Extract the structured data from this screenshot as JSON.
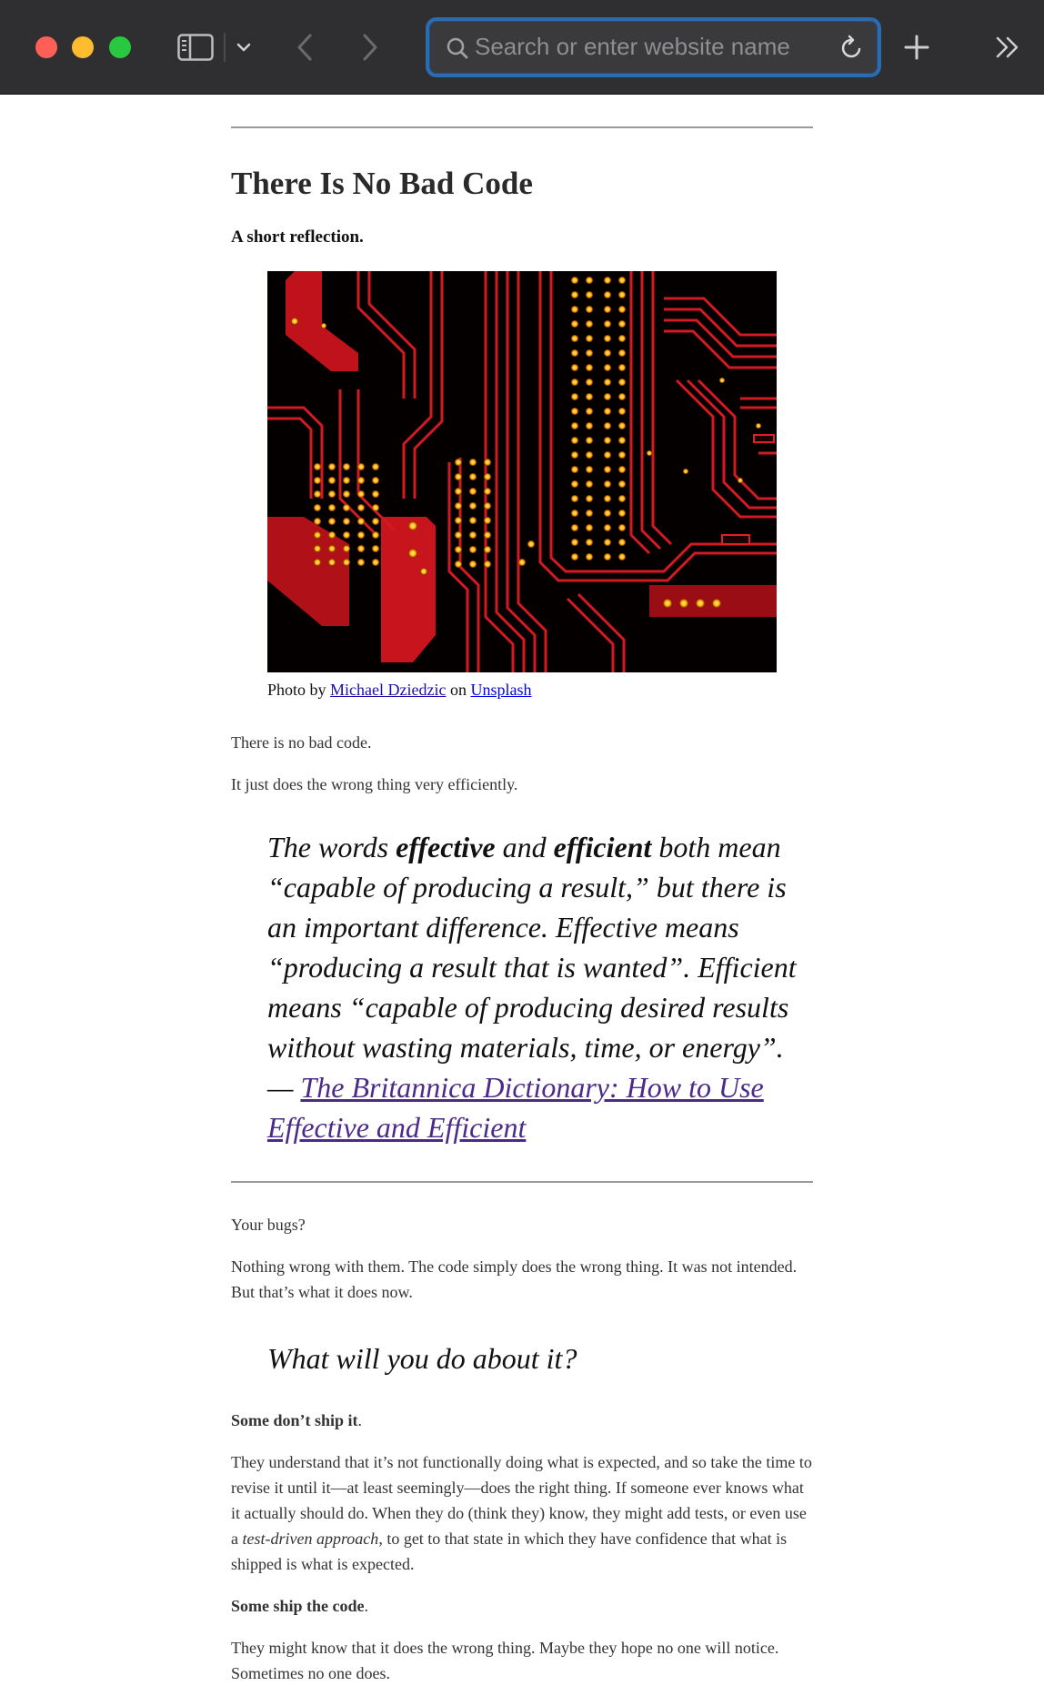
{
  "browser": {
    "address_placeholder": "Search or enter website name"
  },
  "article": {
    "title": "There Is No Bad Code",
    "subtitle": "A short reflection.",
    "image_caption": {
      "prefix": "Photo by",
      "author": "Michael Dziedzic",
      "middle": "on",
      "source": "Unsplash"
    },
    "p1": "There is no bad code.",
    "p2": "It just does the wrong thing very efficiently.",
    "quote": {
      "part1": "The words ",
      "effective": "effective",
      "part2": " and ",
      "efficient": "efficient",
      "part3": " both mean “capable of producing a result,” but there is an important difference. Effective means “producing a result that is wanted”. Efficient means “capable of producing desired results without wasting materials, time, or energy”. — ",
      "link": "The Britannica Dictionary: How to Use Effective and Efficient"
    },
    "p3": "Your bugs?",
    "p4": "Nothing wrong with them. The code simply does the wrong thing. It was not intended. But that’s what it does now.",
    "heading": "What will you do about it?",
    "p5_bold": "Some don’t ship it",
    "p5_rest": ".",
    "p6_a": "They understand that it’s not functionally doing what is expected, and so take the time to revise it until it—at least seemingly—does the right thing. If someone ever knows what it actually should do. When they do (think they) know, they might add tests, or even use a ",
    "p6_em": "test-driven approach",
    "p6_b": ", to get to that state in which they have confidence that what is shipped is what is expected.",
    "p7_bold": "Some ship the code",
    "p7_rest": ".",
    "p8": "They might know that it does the wrong thing. Maybe they hope no one will notice. Sometimes no one does."
  },
  "colors": {
    "toolbar_bg": "#2f2f31",
    "address_focus": "#2b6cb0",
    "link": "#0000ee",
    "visited_link": "#4b2a8a"
  }
}
